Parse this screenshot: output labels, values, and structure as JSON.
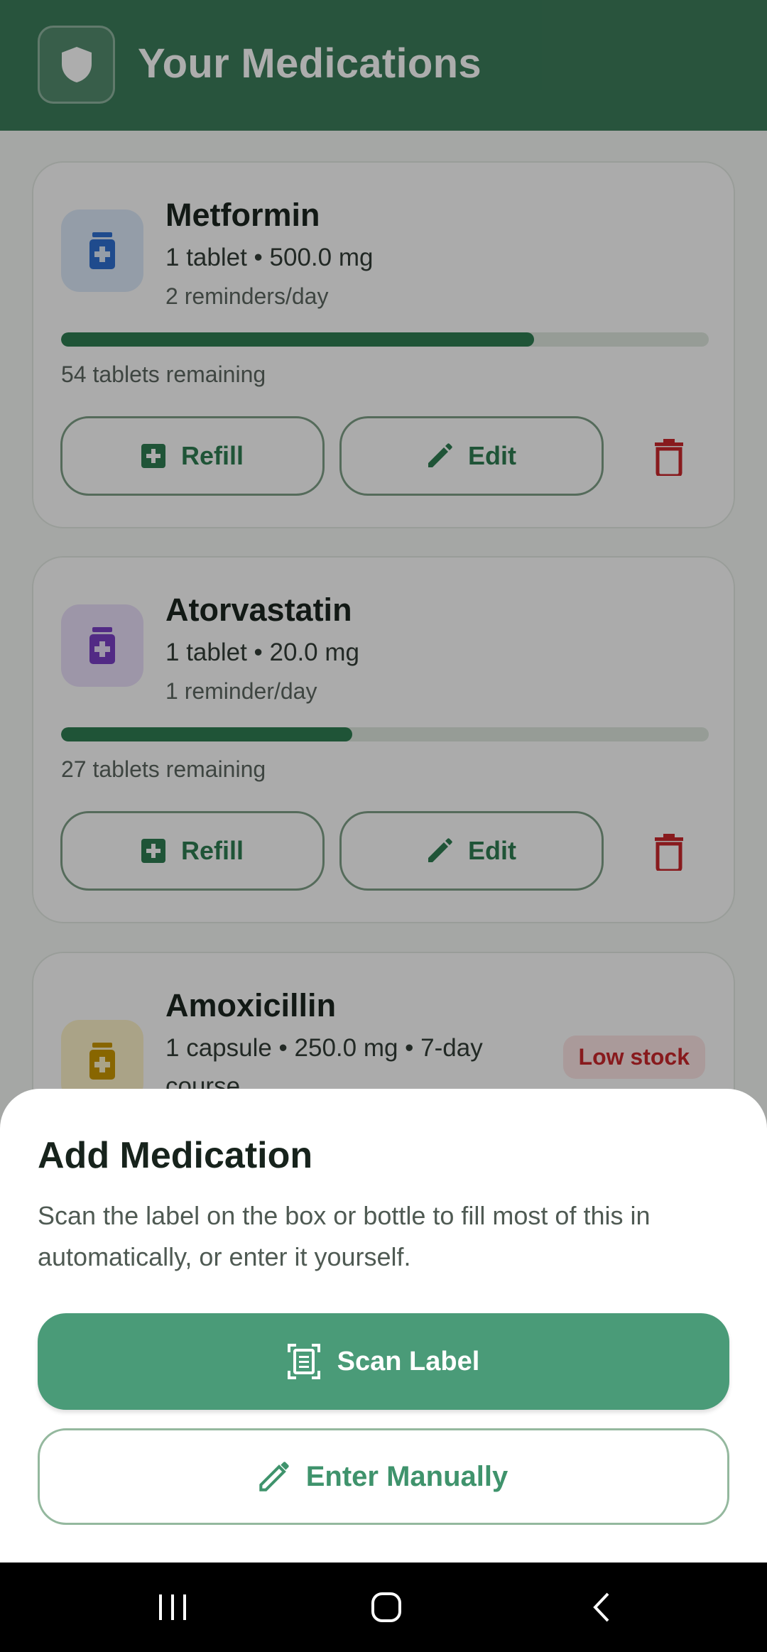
{
  "header": {
    "title": "Your Medications",
    "icon": "shield-icon"
  },
  "medications": [
    {
      "name": "Metformin",
      "dose": "1 tablet • 500.0 mg",
      "reminders": "2 reminders/day",
      "remaining": "54 tablets remaining",
      "stock_fraction": 0.73,
      "icon_color": "#2f6fd0",
      "icon_bg": "#dbe7f8",
      "refill_label": "Refill",
      "edit_label": "Edit"
    },
    {
      "name": "Atorvastatin",
      "dose": "1 tablet • 20.0 mg",
      "reminders": "1 reminder/day",
      "remaining": "27 tablets remaining",
      "stock_fraction": 0.45,
      "icon_color": "#7a3fc4",
      "icon_bg": "#e8def8",
      "refill_label": "Refill",
      "edit_label": "Edit"
    },
    {
      "name": "Amoxicillin",
      "dose_line1": "1 capsule • 250.0 mg • 7-day",
      "dose_line2": "course",
      "badge": "Low stock",
      "icon_color": "#c99700",
      "icon_bg": "#fbf0c8"
    }
  ],
  "sheet": {
    "title": "Add Medication",
    "description": "Scan the label on the box or bottle to fill most of this in automatically, or enter it yourself.",
    "scan_label": "Scan Label",
    "manual_label": "Enter Manually"
  },
  "colors": {
    "primary": "#4a9b78",
    "header": "#3c7c5a",
    "danger": "#c9272c"
  }
}
